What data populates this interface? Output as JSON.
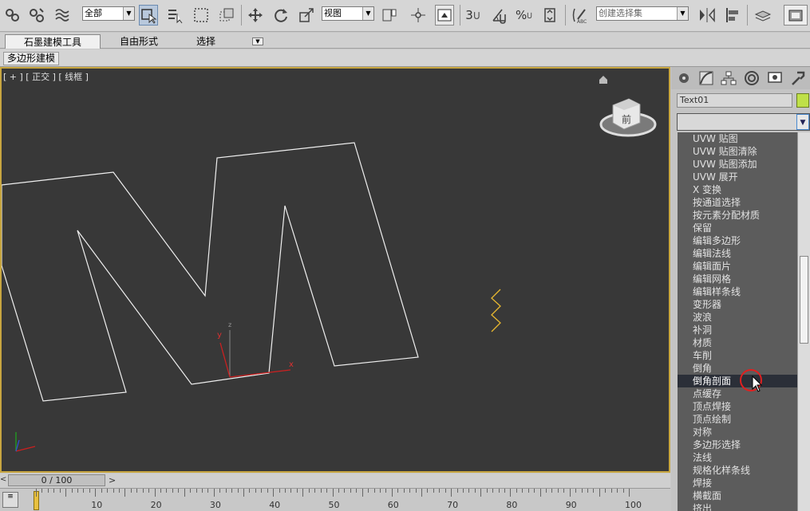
{
  "toolbar": {
    "selection_filter": "全部",
    "ref_coord": "视图",
    "named_selection": "创建选择集",
    "snap_label": "3",
    "angle_snap_label": "",
    "percent_label": "%"
  },
  "ribbon": {
    "tabs": [
      "石墨建模工具",
      "自由形式",
      "选择"
    ]
  },
  "subbar": {
    "label": "多边形建模"
  },
  "viewport": {
    "label": "[ + ] [ 正交 ] [ 线框 ]",
    "viewcube_face": "前",
    "axis_x": "x",
    "axis_y": "y",
    "axis_z": "z"
  },
  "panel": {
    "object_name": "Text01",
    "color_swatch": "#bfe048",
    "modifiers": [
      "UVW 贴图",
      "UVW 贴图清除",
      "UVW 贴图添加",
      "UVW 展开",
      "X 变换",
      "按通道选择",
      "按元素分配材质",
      "保留",
      "编辑多边形",
      "编辑法线",
      "编辑面片",
      "编辑网格",
      "编辑样条线",
      "变形器",
      "波浪",
      "补洞",
      "材质",
      "车削",
      "倒角",
      "倒角剖面",
      "点缓存",
      "顶点焊接",
      "顶点绘制",
      "对称",
      "多边形选择",
      "法线",
      "规格化样条线",
      "焊接",
      "横截面",
      "挤出"
    ],
    "selected_modifier": "倒角剖面"
  },
  "timeline": {
    "frame_display": "0 / 100",
    "ticks": [
      "10",
      "20",
      "30",
      "40",
      "50",
      "60",
      "70",
      "80",
      "90",
      "100"
    ]
  }
}
